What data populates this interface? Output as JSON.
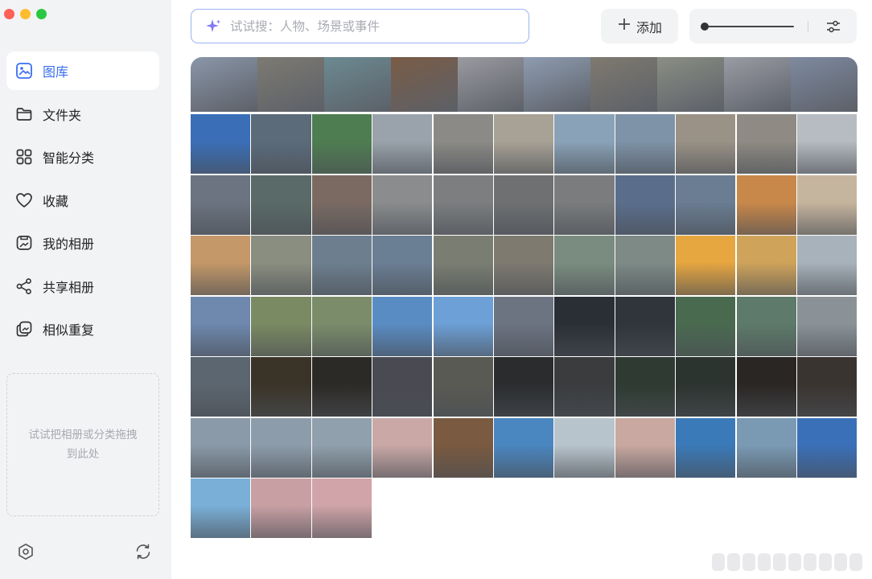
{
  "window": {
    "traffic_colors": [
      "#fe5f57",
      "#febc2e",
      "#28c840"
    ]
  },
  "sidebar": {
    "items": [
      {
        "label": "图库",
        "icon": "gallery-icon",
        "active": true
      },
      {
        "label": "文件夹",
        "icon": "folder-icon",
        "active": false
      },
      {
        "label": "智能分类",
        "icon": "grid-icon",
        "active": false
      },
      {
        "label": "收藏",
        "icon": "heart-icon",
        "active": false
      },
      {
        "label": "我的相册",
        "icon": "album-icon",
        "active": false
      },
      {
        "label": "共享相册",
        "icon": "share-icon",
        "active": false
      },
      {
        "label": "相似重复",
        "icon": "duplicate-icon",
        "active": false
      }
    ],
    "dropzone_text": "试试把相册或分类拖拽到此处",
    "bottom_icons": [
      "settings-icon",
      "sync-icon"
    ]
  },
  "toolbar": {
    "search_placeholder": "试试搜：人物、场景或事件",
    "search_icon": "sparkle-icon",
    "add_label": "添加",
    "zoom_level": 0.0,
    "filter_icon": "filter-settings-icon"
  },
  "colors": {
    "accent": "#3b6ef0",
    "sidebar_bg": "#f2f3f5"
  },
  "gallery": {
    "top_strip": [
      "#8a96a8",
      "#7d7a72",
      "#6c8a92",
      "#7a5c46",
      "#9a9aa0",
      "#8e9cb0",
      "#7f7a70",
      "#8a8e84",
      "#9a9ca4",
      "#7e8aa0"
    ],
    "rows": [
      [
        "#3a6fb8",
        "#5b6b7a",
        "#4f7d52",
        "#9aa3ab",
        "#8b8a86",
        "#a8a296",
        "#8aa2b8",
        "#7e93a8",
        "#9a9286",
        "#8f8b84",
        "#b7bcc2"
      ],
      [
        "#6b7480",
        "#5a6a68",
        "#7a6a62",
        "#8a8c8e",
        "#7c7e80",
        "#6e7072",
        "#7a7c7e",
        "#5a6e8c",
        "#6a7d92",
        "#c8884a",
        "#c6b59e"
      ],
      [
        "#c49868",
        "#8a8e80",
        "#6d7f8e",
        "#6a7e94",
        "#7a7e72",
        "#7e7a70",
        "#7a8c80",
        "#7d8a86",
        "#e6a640",
        "#cfa35a",
        "#a8b2ba"
      ],
      [
        "#6e88ae",
        "#7a8a62",
        "#7a8c6a",
        "#5a8cc4",
        "#6ca0d6",
        "#6c7482",
        "#2a2f36",
        "#30353c",
        "#4a6a50",
        "#5e7a6a",
        "#8a9298"
      ],
      [
        "#5c6670",
        "#3a3428",
        "#2c2a26",
        "#4a4a52",
        "#5a5a54",
        "#2a2c2e",
        "#3a3c3e",
        "#2e3a32",
        "#2c3430",
        "#2a2624",
        "#3a3430"
      ],
      [
        "#8a9aa8",
        "#8d9caa",
        "#90a0ac",
        "#c9a8a6",
        "#7a5a40",
        "#4a86c0",
        "#b8c4cc",
        "#c8a8a0",
        "#3a7ab8",
        "#7a9ab4",
        "#3a70b8"
      ],
      [
        "#7ab0d8",
        "#c8a0a4",
        "#d0a4a8"
      ]
    ]
  }
}
